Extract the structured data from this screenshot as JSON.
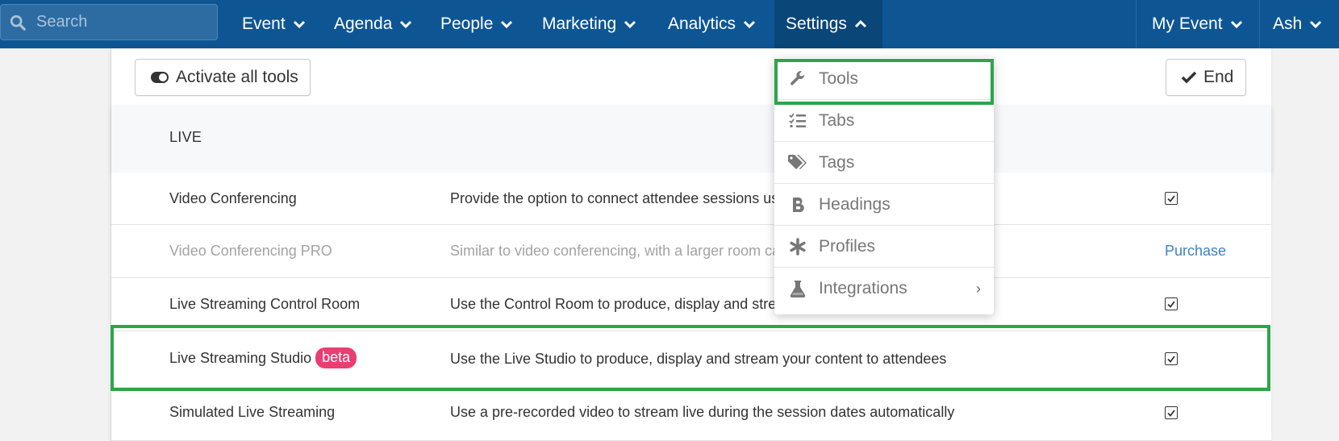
{
  "nav": {
    "search_placeholder": "Search",
    "items": [
      {
        "label": "Event"
      },
      {
        "label": "Agenda"
      },
      {
        "label": "People"
      },
      {
        "label": "Marketing"
      },
      {
        "label": "Analytics"
      },
      {
        "label": "Settings"
      }
    ],
    "right": [
      {
        "label": "My Event"
      },
      {
        "label": "Ash"
      }
    ]
  },
  "toolbar": {
    "activate_label": "Activate all tools",
    "end_label": "End"
  },
  "section": {
    "title": "LIVE"
  },
  "rows": [
    {
      "name": "Video Conferencing",
      "desc": "Provide the option to connect attendee sessions us",
      "action": "checkbox"
    },
    {
      "name": "Video Conferencing PRO",
      "desc": "Similar to video conferencing, with a larger room ca",
      "action": "Purchase"
    },
    {
      "name": "Live Streaming Control Room",
      "desc": "Use the Control Room to produce, display and strea",
      "action": "checkbox"
    },
    {
      "name": "Live Streaming Studio",
      "badge": "beta",
      "desc": "Use the Live Studio to produce, display and stream your content to attendees",
      "action": "checkbox"
    },
    {
      "name": "Simulated Live Streaming",
      "desc": "Use a pre-recorded video to stream live during the session dates automatically",
      "action": "checkbox"
    }
  ],
  "settings_menu": [
    {
      "label": "Tools",
      "icon": "wrench-icon"
    },
    {
      "label": "Tabs",
      "icon": "checklist-icon"
    },
    {
      "label": "Tags",
      "icon": "tags-icon"
    },
    {
      "label": "Headings",
      "icon": "bold-icon"
    },
    {
      "label": "Profiles",
      "icon": "asterisk-icon"
    },
    {
      "label": "Integrations",
      "icon": "flask-icon",
      "submenu_arrow": "›"
    }
  ],
  "colors": {
    "nav_bg": "#0e5693",
    "nav_active": "#0a4677",
    "highlight": "#2aa64a",
    "badge": "#e83e72",
    "link": "#3d82c4"
  }
}
